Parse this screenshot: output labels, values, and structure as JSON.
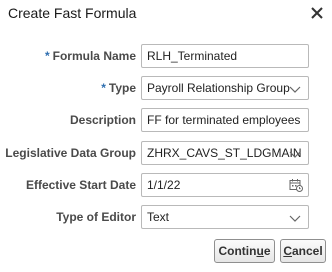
{
  "dialog": {
    "title": "Create Fast Formula"
  },
  "form": {
    "required_marker": "*",
    "formula_name": {
      "label": "Formula Name",
      "value": "RLH_Terminated",
      "required": true
    },
    "type": {
      "label": "Type",
      "value": "Payroll Relationship Group",
      "required": true
    },
    "description": {
      "label": "Description",
      "value": "FF for terminated employees"
    },
    "legislative_data_group": {
      "label": "Legislative Data Group",
      "value": "ZHRX_CAVS_ST_LDGMAIN"
    },
    "effective_start_date": {
      "label": "Effective Start Date",
      "value": "1/1/22"
    },
    "type_of_editor": {
      "label": "Type of Editor",
      "value": "Text"
    }
  },
  "buttons": {
    "continue_pre": "Contin",
    "continue_mnemonic": "u",
    "continue_post": "e",
    "cancel_mnemonic": "C",
    "cancel_post": "ancel"
  },
  "icons": {
    "close": "close-icon",
    "dropdown": "chevron-down-icon",
    "calendar": "calendar-icon"
  },
  "colors": {
    "required": "#2f6fb0",
    "label": "#4a4a4a",
    "border": "#b9b9b9"
  }
}
